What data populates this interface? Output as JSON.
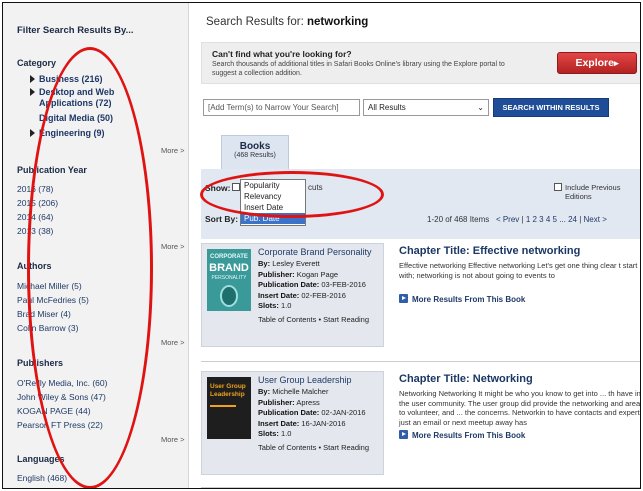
{
  "sidebar": {
    "title": "Filter Search Results By...",
    "category": {
      "heading": "Category",
      "items": [
        "Business (216)",
        "Desktop and Web",
        "Applications (72)",
        "Digital Media (50)",
        "Engineering (9)"
      ],
      "more": "More >"
    },
    "publication_year": {
      "heading": "Publication Year",
      "items": [
        "2016 (78)",
        "2015 (206)",
        "2014 (64)",
        "2013 (38)"
      ],
      "more": "More >"
    },
    "authors": {
      "heading": "Authors",
      "items": [
        "Michael Miller (5)",
        "Paul McFedries (5)",
        "Brad Miser (4)",
        "Colin Barrow (3)"
      ],
      "more": "More >"
    },
    "publishers": {
      "heading": "Publishers",
      "items": [
        "O'Reilly Media, Inc. (60)",
        "John Wiley & Sons (47)",
        "KOGAN PAGE (44)",
        "Pearson FT Press (22)"
      ],
      "more": "More >"
    },
    "languages": {
      "heading": "Languages",
      "items": [
        "English (468)"
      ]
    }
  },
  "header": {
    "label": "Search Results for:",
    "query": "networking"
  },
  "promo": {
    "heading": "Can't find what you're looking for?",
    "text": "Search thousands of additional titles in Safari Books Online's library using the Explore portal to suggest a collection addition.",
    "button": "Explore"
  },
  "search": {
    "term_placeholder": "[Add Term(s) to Narrow Your Search]",
    "scope": "All Results",
    "button": "SEARCH WITHIN RESULTS"
  },
  "tab": {
    "name": "Books",
    "count": "(468 Results)"
  },
  "filters": {
    "show_label": "Show:",
    "sort_options": [
      "Popularity",
      "Relevancy",
      "Insert Date",
      "Pub. Date"
    ],
    "selected_sort": "Pub. Date",
    "cuts_text": "cuts",
    "include_previous": "Include Previous Editions",
    "sort_label": "Sort By:",
    "range": "1-20 of 468 Items",
    "prev": "< Prev",
    "pages": "1  2  3  4  5 ... 24",
    "next": "Next >"
  },
  "results": [
    {
      "book_title": "Corporate Brand Personality",
      "by_label": "By:",
      "by": "Lesley Everett",
      "publisher_label": "Publisher:",
      "publisher": "Kogan Page",
      "pub_date_label": "Publication Date:",
      "pub_date": "03-FEB-2016",
      "insert_date_label": "Insert Date:",
      "insert_date": "02-FEB-2016",
      "slots_label": "Slots:",
      "slots": "1.0",
      "links": "Table of Contents • Start Reading",
      "cover_lines": [
        "CORPORATE",
        "BRAND",
        "PERSONALITY"
      ],
      "chapter_label": "Chapter Title:",
      "chapter": "Effective networking",
      "snippet": "Effective networking Effective networking Let's get one thing clear t start with; networking is not about going to events to",
      "more_results": "More Results From This Book",
      "cover_color": "#3a9a9a"
    },
    {
      "book_title": "User Group Leadership",
      "by_label": "By:",
      "by": "Michelle Malcher",
      "publisher_label": "Publisher:",
      "publisher": "Apress",
      "pub_date_label": "Publication Date:",
      "pub_date": "02-JAN-2016",
      "insert_date_label": "Insert Date:",
      "insert_date": "16-JAN-2016",
      "slots_label": "Slots:",
      "slots": "1.0",
      "links": "Table of Contents • Start Reading",
      "cover_lines": [
        "User Group",
        "Leadership"
      ],
      "chapter_label": "Chapter Title:",
      "chapter": "Networking",
      "snippet": "Networking Networking It might be who you know to get into ... th have in the user community. The user group did provide the networking and areas to volunteer, and ... the concerns. Networkin to have contacts and experts just an email or next meetup away has",
      "more_results": "More Results From This Book",
      "cover_color": "#1e1e1e"
    }
  ],
  "colors": {
    "accent_blue": "#1f4d97",
    "explore_red": "#c82a2a",
    "annotation_red": "#e01313"
  }
}
